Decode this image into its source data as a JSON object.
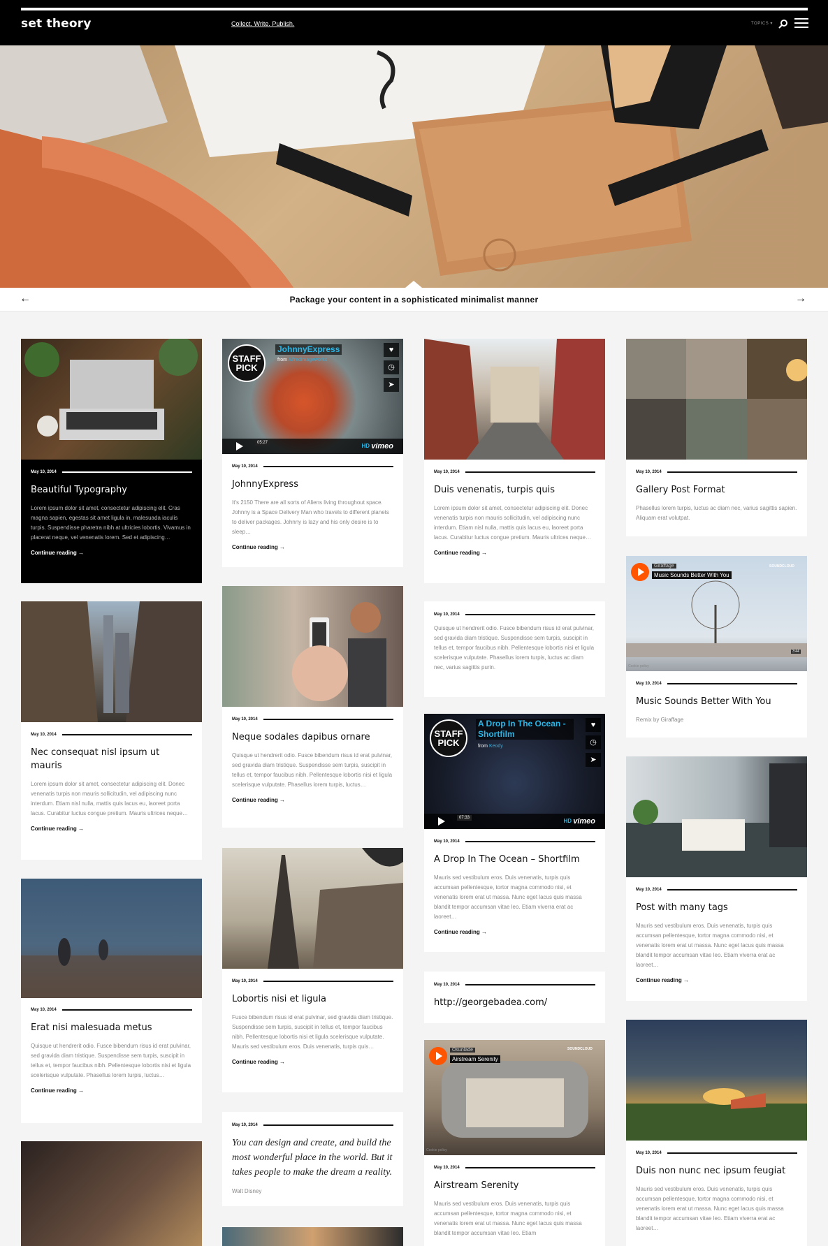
{
  "header": {
    "logo": "set theory",
    "tagline": "Collect. Write. Publish.",
    "topics": "TOPICS ▾",
    "search_icon": "search-icon",
    "menu_icon": "hamburger-icon"
  },
  "slider": {
    "caption": "Package your content in a sophisticated minimalist manner",
    "prev": "←",
    "next": "→"
  },
  "posts": {
    "c1": {
      "date": "May 10, 2014",
      "title": "Beautiful Typography",
      "excerpt": "Lorem ipsum dolor sit amet, consectetur adipiscing elit. Cras magna sapien, egestas sit amet ligula in, malesuada iaculis turpis. Suspendisse pharetra nibh at ultricies lobortis. Vivamus in placerat neque, vel venenatis lorem. Sed et adipiscing…",
      "more": "Continue reading →"
    },
    "c2": {
      "date": "May 10, 2014",
      "title": "Nec consequat nisl ipsum ut mauris",
      "excerpt": "Lorem ipsum dolor sit amet, consectetur adipiscing elit. Donec venenatis turpis non mauris sollicitudin, vel adipiscing nunc interdum. Etiam nisl nulla, mattis quis lacus eu, laoreet porta lacus. Curabitur luctus congue pretium. Mauris ultrices neque…",
      "more": "Continue reading →"
    },
    "c3": {
      "date": "May 10, 2014",
      "title": "Erat nisi malesuada metus",
      "excerpt": "Quisque ut hendrerit odio. Fusce bibendum risus id erat pulvinar, sed gravida diam tristique. Suspendisse sem turpis, suscipit in tellus et, tempor faucibus nibh. Pellentesque lobortis nisi et ligula scelerisque vulputate. Phasellus lorem turpis, luctus…",
      "more": "Continue reading →"
    },
    "c5": {
      "date": "May 10, 2014",
      "title": "JohnnyExpress",
      "excerpt": "It's 2150 There are all sorts of Aliens living throughout space. Johnny is a Space Delivery Man who travels to different planets to deliver packages. Johnny is lazy and his only desire is to sleep…",
      "more": "Continue reading →",
      "video_title": "JohnnyExpress",
      "video_from": "from",
      "video_author": "Alfredimageworks",
      "video_badge": "PLUS",
      "video_time": "05:27",
      "staff_pick": "STAFF PICK",
      "vimeo": "vimeo",
      "hd": "HD"
    },
    "c6": {
      "date": "May 10, 2014",
      "title": "Neque sodales dapibus ornare",
      "excerpt": "Quisque ut hendrerit odio. Fusce bibendum risus id erat pulvinar, sed gravida diam tristique. Suspendisse sem turpis, suscipit in tellus et, tempor faucibus nibh. Pellentesque lobortis nisi et ligula scelerisque vulputate. Phasellus lorem turpis, luctus…",
      "more": "Continue reading →"
    },
    "c7": {
      "date": "May 10, 2014",
      "title": "Lobortis nisi et ligula",
      "excerpt": "Fusce bibendum risus id erat pulvinar, sed gravida diam tristique. Suspendisse sem turpis, suscipit in tellus et, tempor faucibus nibh. Pellentesque lobortis nisi et ligula scelerisque vulputate. Mauris sed vestibulum eros. Duis venenatis, turpis quis…",
      "more": "Continue reading →"
    },
    "c8": {
      "date": "May 10, 2014",
      "quote": "You can design and create, and build the most wonderful place in the world. But it takes people to make the dream a reality.",
      "source": "Walt Disney"
    },
    "c10": {
      "date": "May 10, 2014",
      "title": "Duis venenatis, turpis quis",
      "excerpt": "Lorem ipsum dolor sit amet, consectetur adipiscing elit. Donec venenatis turpis non mauris sollicitudin, vel adipiscing nunc interdum. Etiam nisl nulla, mattis quis lacus eu, laoreet porta lacus. Curabitur luctus congue pretium. Mauris ultrices neque…",
      "more": "Continue reading →"
    },
    "c11": {
      "date": "May 10, 2014",
      "excerpt": "Quisque ut hendrerit odio. Fusce bibendum risus id erat pulvinar, sed gravida diam tristique. Suspendisse sem turpis, suscipit in tellus et, tempor faucibus nibh. Pellentesque lobortis nisi et ligula scelerisque vulputate. Phasellus lorem turpis, luctus ac diam nec, varius sagittis purin."
    },
    "c12": {
      "date": "May 10, 2014",
      "title": "A Drop In The Ocean – Shortfilm",
      "excerpt": "Mauris sed vestibulum eros. Duis venenatis, turpis quis accumsan pellentesque, tortor magna commodo nisi, et venenatis lorem erat ut massa. Nunc eget lacus quis massa blandit tempor accumsan vitae leo. Etiam viverra erat ac laoreet…",
      "more": "Continue reading →",
      "video_title": "A Drop In The Ocean - Shortfilm",
      "video_from": "from",
      "video_author": "Keody",
      "video_badge": "PLUS",
      "video_time": "07:33",
      "staff_pick": "STAFF PICK",
      "vimeo": "vimeo",
      "hd": "HD"
    },
    "c13": {
      "date": "May 10, 2014",
      "link": "http://georgebadea.com/"
    },
    "c14": {
      "date": "May 10, 2014",
      "title": "Airstream Serenity",
      "excerpt": "Mauris sed vestibulum eros. Duis venenatis, turpis quis accumsan pellentesque, tortor magna commodo nisi, et venenatis lorem erat ut massa. Nunc eget lacus quis massa blandit tempor accumsan vitae leo. Etiam",
      "sc_artist": "Osunlade",
      "sc_track": "Airstream Serenity",
      "sc_logo": "SOUNDCLOUD",
      "sc_cookie": "Cookie policy"
    },
    "c15": {
      "date": "May 10, 2014",
      "title": "Gallery Post Format",
      "excerpt": "Phasellus lorem turpis, luctus ac diam nec, varius sagittis sapien. Aliquam erat volutpat."
    },
    "c16": {
      "date": "May 10, 2014",
      "title": "Music Sounds Better With You",
      "excerpt": "Remix by Giraffage",
      "sc_artist": "Giraffage",
      "sc_track": "Music Sounds Better With You",
      "sc_logo": "SOUNDCLOUD",
      "sc_cookie": "Cookie policy",
      "sc_time": "3:44"
    },
    "c17": {
      "date": "May 10, 2014",
      "title": "Post with many tags",
      "excerpt": "Mauris sed vestibulum eros. Duis venenatis, turpis quis accumsan pellentesque, tortor magna commodo nisi, et venenatis lorem erat ut massa. Nunc eget lacus quis massa blandit tempor accumsan vitae leo. Etiam viverra erat ac laoreet…",
      "more": "Continue reading →"
    },
    "c18": {
      "date": "May 10, 2014",
      "title": "Duis non nunc nec ipsum feugiat",
      "excerpt": "Mauris sed vestibulum eros. Duis venenatis, turpis quis accumsan pellentesque, tortor magna commodo nisi, et venenatis lorem erat ut massa. Nunc eget lacus quis massa blandit tempor accumsan vitae leo. Etiam viverra erat ac laoreet…"
    }
  }
}
